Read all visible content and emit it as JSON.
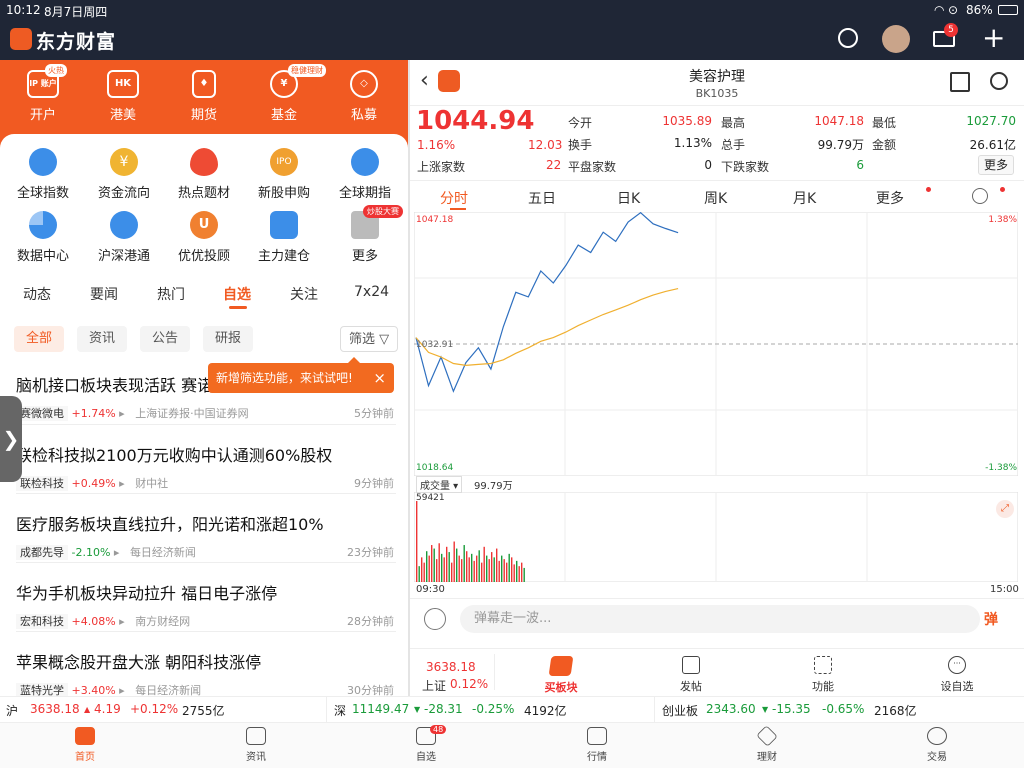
{
  "status": {
    "time": "10:12",
    "date": "8月7日周四",
    "battery": "86%"
  },
  "app": {
    "brand": "东方财富",
    "mail_badge": "5"
  },
  "left": {
    "top_icons": [
      {
        "label": "开户",
        "icon": "IP 账户",
        "badge": "火热"
      },
      {
        "label": "港美",
        "icon": "HK",
        "badge": ""
      },
      {
        "label": "期货",
        "icon": "♦",
        "badge": ""
      },
      {
        "label": "基金",
        "icon": "¥",
        "badge": "稳健理财"
      },
      {
        "label": "私募",
        "icon": "◇",
        "badge": ""
      }
    ],
    "grid_icons": [
      {
        "label": "全球指数",
        "color": "#3c8ee8"
      },
      {
        "label": "资金流向",
        "color": "#f0b432"
      },
      {
        "label": "热点题材",
        "color": "#ee4b34"
      },
      {
        "label": "新股申购",
        "color": "#f0a030",
        "icon": "IPO"
      },
      {
        "label": "全球期指",
        "color": "#3c8ee8"
      },
      {
        "label": "数据中心",
        "color": "#3c8ee8"
      },
      {
        "label": "沪深港通",
        "color": "#3c8ee8"
      },
      {
        "label": "优优投顾",
        "color": "#f08030",
        "icon": "U"
      },
      {
        "label": "主力建仓",
        "color": "#3c8ee8"
      },
      {
        "label": "更多",
        "color": "#aaa",
        "badge": "炒股大赛"
      }
    ],
    "feed_tabs": [
      "动态",
      "要闻",
      "热门",
      "自选",
      "关注",
      "7x24"
    ],
    "active_tab": "自选",
    "chips": [
      "全部",
      "资讯",
      "公告",
      "研报"
    ],
    "filter_label": "筛选",
    "tooltip": "新增筛选功能，来试试吧!",
    "news": [
      {
        "title": "脑机接口板块表现活跃 赛诺",
        "stock": "赛微微电",
        "chg": "+1.74%",
        "src": "上海证券报·中国证券网",
        "time": "5分钟前",
        "dir": "up"
      },
      {
        "title": "联检科技拟2100万元收购中认通测60%股权",
        "stock": "联检科技",
        "chg": "+0.49%",
        "src": "财中社",
        "time": "9分钟前",
        "dir": "up"
      },
      {
        "title": "医疗服务板块直线拉升，阳光诺和涨超10%",
        "stock": "成都先导",
        "chg": "-2.10%",
        "src": "每日经济新闻",
        "time": "23分钟前",
        "dir": "down"
      },
      {
        "title": "华为手机板块异动拉升 福日电子涨停",
        "stock": "宏和科技",
        "chg": "+4.08%",
        "src": "南方财经网",
        "time": "28分钟前",
        "dir": "up"
      },
      {
        "title": "苹果概念股开盘大涨 朝阳科技涨停",
        "stock": "蓝特光学",
        "chg": "+3.40%",
        "src": "每日经济新闻",
        "time": "30分钟前",
        "dir": "up"
      }
    ]
  },
  "right": {
    "title": "美容护理",
    "code": "BK1035",
    "price": "1044.94",
    "pct": "1.16%",
    "chg": "12.03",
    "rising_label": "上涨家数",
    "rising": "22",
    "quote": {
      "open_l": "今开",
      "open": "1035.89",
      "high_l": "最高",
      "high": "1047.18",
      "low_l": "最低",
      "low": "1027.70",
      "turn_l": "换手",
      "turn": "1.13%",
      "vol_l": "总手",
      "vol": "99.79万",
      "amt_l": "金额",
      "amt": "26.61亿",
      "flat_l": "平盘家数",
      "flat": "0",
      "fall_l": "下跌家数",
      "fall": "6",
      "more": "更多"
    },
    "chart_tabs": [
      "分时",
      "五日",
      "日K",
      "周K",
      "月K",
      "更多"
    ],
    "active_chart_tab": "分时",
    "axis": {
      "max": "1047.18",
      "min": "1018.64",
      "mid": "1032.91",
      "pct_max": "1.38%",
      "pct_min": "-1.38%",
      "t_start": "09:30",
      "t_end": "15:00"
    },
    "vol_label": "成交量",
    "vol_total": "99.79万",
    "vol_max": "59421",
    "danmu_placeholder": "弹幕走一波...",
    "danmu_btn": "弹",
    "bottom_idx": {
      "value": "3638.18",
      "name": "上证",
      "pct": "0.12%"
    },
    "actions": [
      "买板块",
      "发帖",
      "功能",
      "设自选"
    ]
  },
  "index_bar": [
    {
      "name": "沪",
      "value": "3638.18",
      "chg": "4.19",
      "pct": "+0.12%",
      "amt": "2755亿",
      "dir": "up"
    },
    {
      "name": "深",
      "value": "11149.47",
      "chg": "-28.31",
      "pct": "-0.25%",
      "amt": "4192亿",
      "dir": "down"
    },
    {
      "name": "创业板",
      "value": "2343.60",
      "chg": "-15.35",
      "pct": "-0.65%",
      "amt": "2168亿",
      "dir": "down"
    }
  ],
  "tabbar": [
    {
      "label": "首页",
      "active": true
    },
    {
      "label": "资讯"
    },
    {
      "label": "自选",
      "badge": "48"
    },
    {
      "label": "行情"
    },
    {
      "label": "理财"
    },
    {
      "label": "交易"
    }
  ],
  "chart_data": {
    "type": "line",
    "title": "美容护理 分时",
    "xlabel": "",
    "ylabel": "",
    "ylim": [
      1018.64,
      1047.18
    ],
    "x": [
      "09:30",
      "09:32",
      "09:34",
      "09:36",
      "09:38",
      "09:40",
      "09:42",
      "09:44",
      "09:46",
      "09:48",
      "09:50",
      "09:52",
      "09:54",
      "09:56",
      "09:58",
      "10:00",
      "10:02",
      "10:04",
      "10:06",
      "10:08",
      "10:10",
      "10:12"
    ],
    "series": [
      {
        "name": "价格",
        "values": [
          1033.6,
          1028.4,
          1031.5,
          1027.8,
          1030.9,
          1032.5,
          1030.2,
          1034.8,
          1038.5,
          1038.0,
          1040.8,
          1039.5,
          1041.4,
          1043.6,
          1042.8,
          1045.0,
          1044.0,
          1046.1,
          1047.1,
          1045.9,
          1045.4,
          1044.94
        ]
      },
      {
        "name": "均价",
        "values": [
          1033.6,
          1032.0,
          1031.5,
          1030.8,
          1030.6,
          1030.7,
          1030.8,
          1031.2,
          1031.9,
          1032.5,
          1033.2,
          1033.6,
          1034.2,
          1034.9,
          1035.5,
          1036.1,
          1036.6,
          1037.1,
          1037.7,
          1038.2,
          1038.6,
          1038.9
        ]
      }
    ],
    "volume_max": 59421
  }
}
